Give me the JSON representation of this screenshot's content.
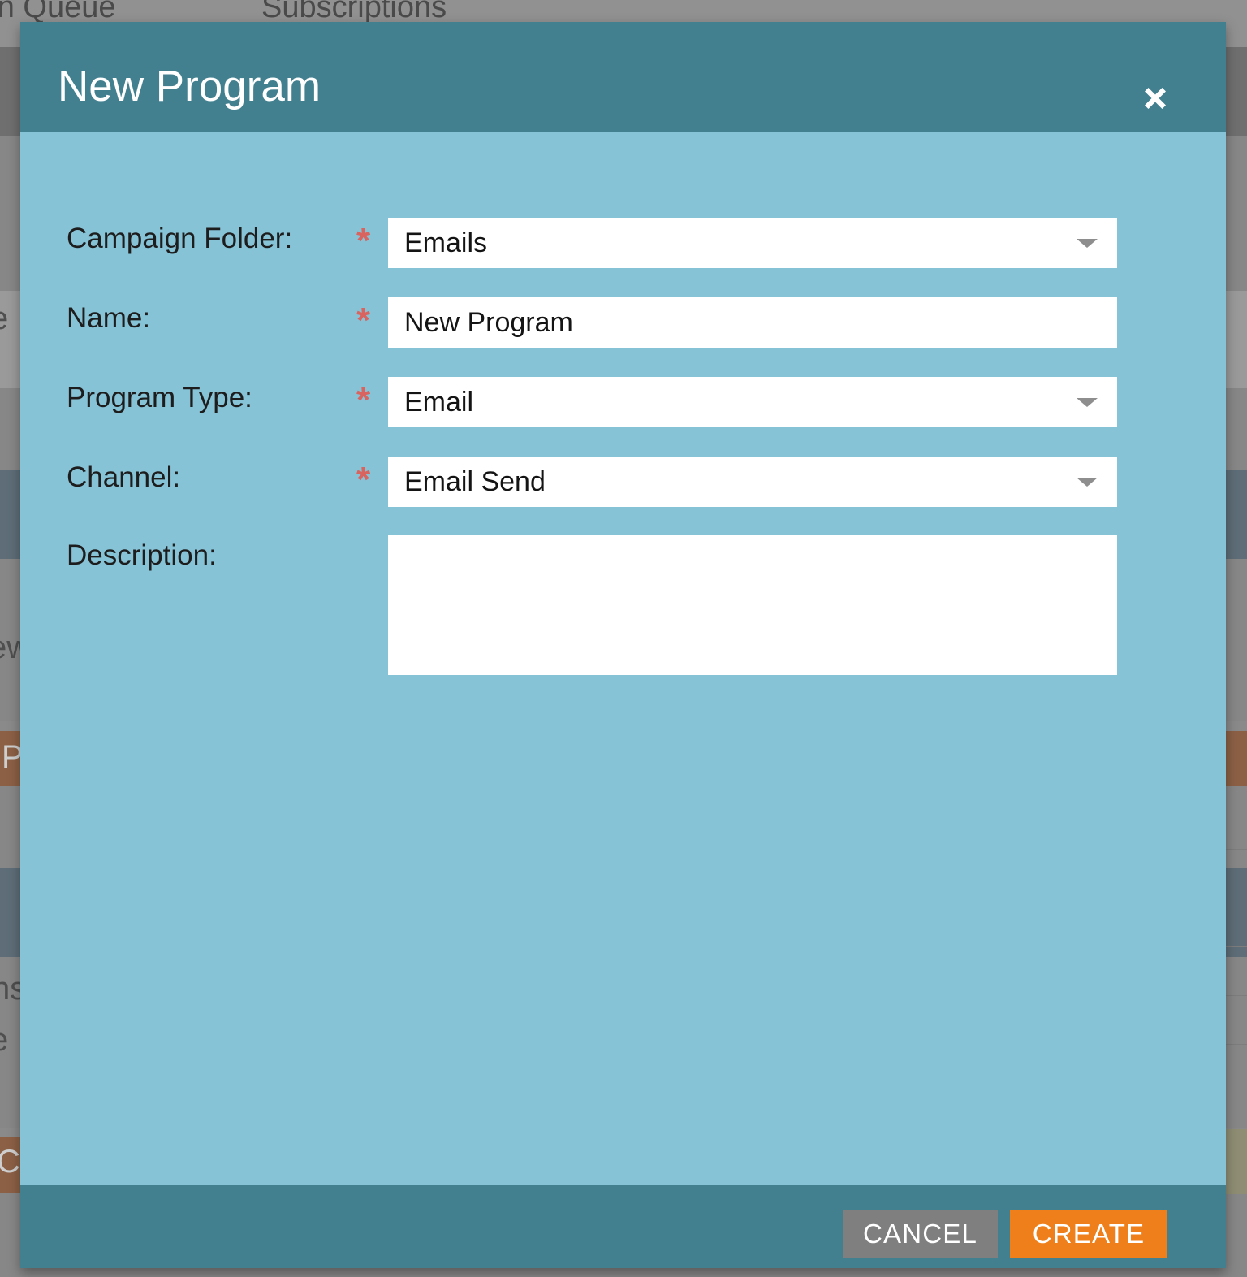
{
  "background": {
    "tabs": [
      {
        "label": "aign Queue"
      },
      {
        "label": "Subscriptions"
      }
    ],
    "fragments": [
      {
        "label": "e"
      },
      {
        "label": "ew"
      },
      {
        "label": "P"
      },
      {
        "label": "ns"
      },
      {
        "label": "e"
      },
      {
        "label": "C"
      }
    ]
  },
  "modal": {
    "title": "New Program",
    "close_icon": "close-icon",
    "fields": [
      {
        "label": "Campaign Folder:",
        "required": true,
        "required_marker": "*",
        "control": "select",
        "value": "Emails",
        "placeholder": "",
        "caret_icon": "chevron-down-icon"
      },
      {
        "label": "Name:",
        "required": true,
        "required_marker": "*",
        "control": "text",
        "value": "New Program",
        "placeholder": ""
      },
      {
        "label": "Program Type:",
        "required": true,
        "required_marker": "*",
        "control": "select",
        "value": "Email",
        "placeholder": "",
        "caret_icon": "chevron-down-icon"
      },
      {
        "label": "Channel:",
        "required": true,
        "required_marker": "*",
        "control": "select",
        "value": "Email Send",
        "placeholder": "",
        "caret_icon": "chevron-down-icon"
      },
      {
        "label": "Description:",
        "required": false,
        "required_marker": "",
        "control": "textarea",
        "value": "",
        "placeholder": ""
      }
    ],
    "footer": {
      "cancel_label": "CANCEL",
      "create_label": "CREATE"
    }
  },
  "colors": {
    "header_teal": "#42808F",
    "body_blue": "#86C3D7",
    "footer_teal": "#42808F",
    "required_red": "#D9635E",
    "cancel_gray": "#7F7F7F",
    "create_orange": "#EF7F1A",
    "field_white": "#FFFFFF",
    "caret_gray": "#8E8E8E",
    "overlay_gray": "#8A8A8A"
  }
}
